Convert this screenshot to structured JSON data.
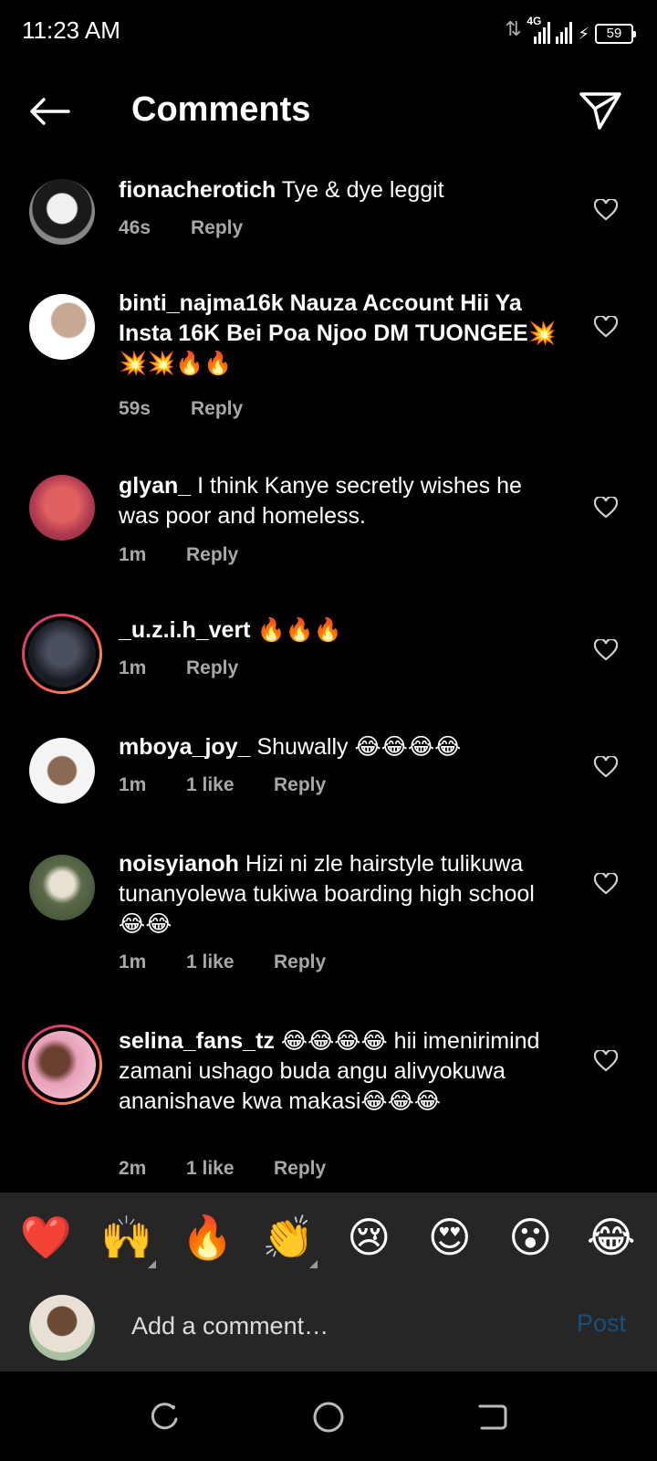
{
  "status_bar": {
    "time": "11:23 AM",
    "network": "4G",
    "battery": "59"
  },
  "header": {
    "title": "Comments",
    "back_icon": "arrow-left-icon",
    "share_icon": "send-icon"
  },
  "comments": [
    {
      "username": "fionacherotich",
      "text": "Tye & dye leggit",
      "time": "46s",
      "likes": "",
      "reply": "Reply",
      "story_ring": false,
      "avatar_color": "#3a3a3a"
    },
    {
      "username": "binti_najma16k",
      "text": "Nauza Account Hii Ya Insta 16K Bei Poa Njoo DM TUONGEE💥💥💥🔥🔥",
      "time": "59s",
      "likes": "",
      "reply": "Reply",
      "story_ring": false,
      "avatar_color": "#c7a892"
    },
    {
      "username": "glyan_",
      "text": "I think Kanye secretly wishes he was poor and homeless.",
      "time": "1m",
      "likes": "",
      "reply": "Reply",
      "story_ring": false,
      "avatar_color": "#c94b4b"
    },
    {
      "username": "_u.z.i.h_vert",
      "text": "🔥🔥🔥",
      "time": "1m",
      "likes": "",
      "reply": "Reply",
      "story_ring": true,
      "avatar_color": "#2b2f3a"
    },
    {
      "username": "mboya_joy_",
      "text": "Shuwally 😂😂😂😂",
      "time": "1m",
      "likes": "1 like",
      "reply": "Reply",
      "story_ring": false,
      "avatar_color": "#8a6a55"
    },
    {
      "username": "noisyianoh",
      "text": "Hizi ni zle hairstyle tulikuwa tunanyolewa tukiwa boarding high school 😂😂",
      "time": "1m",
      "likes": "1 like",
      "reply": "Reply",
      "story_ring": false,
      "avatar_color": "#5a6a4a"
    },
    {
      "username": "selina_fans_tz",
      "text": "😂😂😂😂 hii imenirimind zamani ushago buda angu alivyokuwa ananishave kwa makasi😂😂😂",
      "time": "2m",
      "likes": "1 like",
      "reply": "Reply",
      "story_ring": true,
      "avatar_color": "#e8a0b8"
    }
  ],
  "emoji_bar": [
    {
      "char": "❤️",
      "name": "heart-emoji",
      "variants": false
    },
    {
      "char": "🙌",
      "name": "raised-hands-emoji",
      "variants": true
    },
    {
      "char": "🔥",
      "name": "fire-emoji",
      "variants": false
    },
    {
      "char": "👏",
      "name": "clapping-emoji",
      "variants": true
    },
    {
      "char": "😢",
      "name": "crying-emoji",
      "variants": false
    },
    {
      "char": "😍",
      "name": "heart-eyes-emoji",
      "variants": false
    },
    {
      "char": "😮",
      "name": "surprised-emoji",
      "variants": false
    },
    {
      "char": "😂",
      "name": "laughing-emoji",
      "variants": false
    }
  ],
  "composer": {
    "placeholder": "Add a comment…",
    "post_label": "Post"
  },
  "colors": {
    "background": "#000000",
    "panel": "#262626",
    "muted_text": "#a8a8a8",
    "post_disabled": "#1c4f7a"
  }
}
